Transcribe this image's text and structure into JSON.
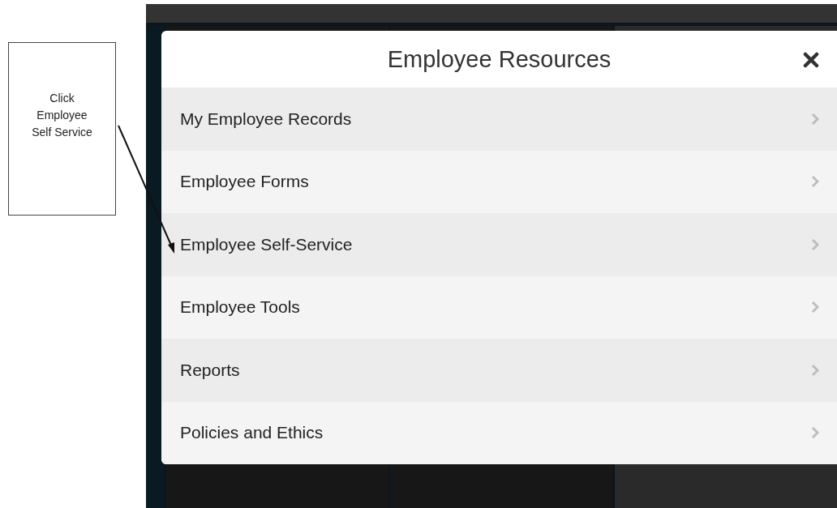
{
  "callout": {
    "text": "Click Employee Self Service"
  },
  "dialog": {
    "title": "Employee Resources",
    "items": [
      {
        "label": "My Employee Records"
      },
      {
        "label": "Employee Forms"
      },
      {
        "label": "Employee Self-Service"
      },
      {
        "label": "Employee Tools"
      },
      {
        "label": "Reports"
      },
      {
        "label": "Policies and Ethics"
      }
    ]
  }
}
